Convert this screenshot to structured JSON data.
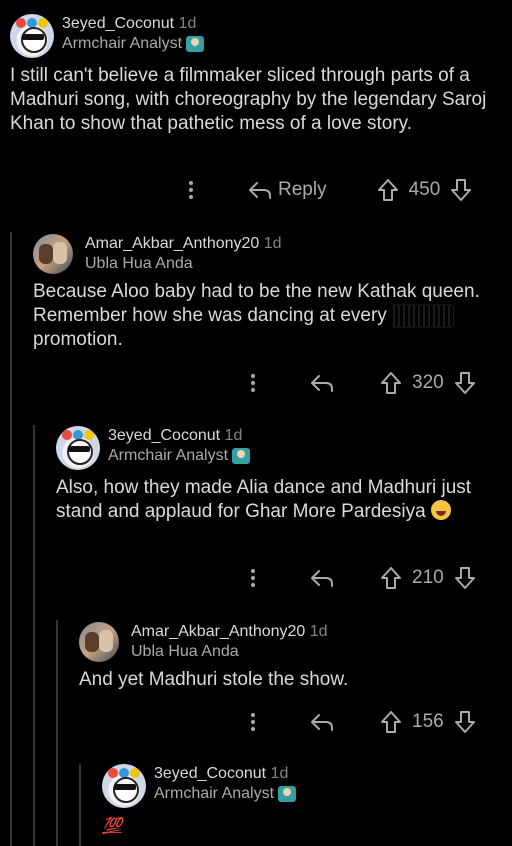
{
  "comments": [
    {
      "username": "3eyed_Coconut",
      "age": "1d",
      "flair": "Armchair Analyst",
      "body": "I still can't believe a filmmaker sliced through parts of a Madhuri song, with choreography by the legendary Saroj Khan to show that pathetic mess of a love story.",
      "reply_label": "Reply",
      "score": "450"
    },
    {
      "username": "Amar_Akbar_Anthony20",
      "age": "1d",
      "flair": "Ubla Hua Anda",
      "body_before": "Because Aloo baby had to be the new Kathak queen. Remember how she was dancing at every ",
      "body_censored": "fucking",
      "body_after": " promotion.",
      "score": "320"
    },
    {
      "username": "3eyed_Coconut",
      "age": "1d",
      "flair": "Armchair Analyst",
      "body": "Also, how they made Alia dance and Madhuri just stand and applaud for Ghar More Pardesiya",
      "score": "210"
    },
    {
      "username": "Amar_Akbar_Anthony20",
      "age": "1d",
      "flair": "Ubla Hua Anda",
      "body": "And yet Madhuri stole the show.",
      "score": "156"
    },
    {
      "username": "3eyed_Coconut",
      "age": "1d",
      "flair": "Armchair Analyst",
      "body": "💯"
    }
  ],
  "icons": {
    "more": "more-options-icon",
    "reply": "reply-arrow-icon",
    "upvote": "upvote-icon",
    "downvote": "downvote-icon"
  },
  "colors": {
    "background": "#000000",
    "text": "#d7dadc",
    "muted": "#818384",
    "thread_line": "#343536"
  }
}
